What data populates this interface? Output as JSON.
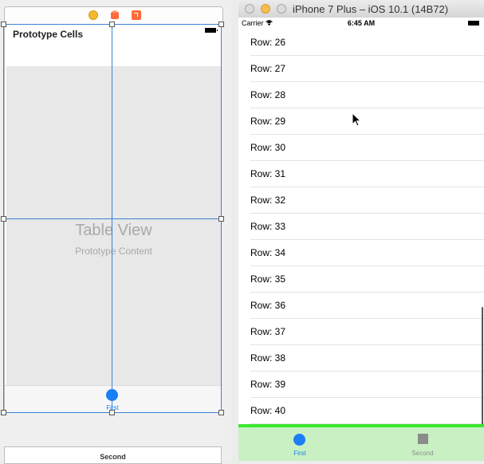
{
  "storyboard": {
    "scene_title": "Prototype Cells",
    "table_view_label": "Table View",
    "table_view_sublabel": "Prototype Content",
    "tab_label": "First",
    "second_scene_label": "Second"
  },
  "simulator": {
    "window_title": "iPhone 7 Plus – iOS 10.1 (14B72)",
    "status_bar": {
      "carrier": "Carrier",
      "time": "6:45 AM"
    },
    "rows": [
      "Row: 26",
      "Row: 27",
      "Row: 28",
      "Row: 29",
      "Row: 30",
      "Row: 31",
      "Row: 32",
      "Row: 33",
      "Row: 34",
      "Row: 35",
      "Row: 36",
      "Row: 37",
      "Row: 38",
      "Row: 39",
      "Row: 40"
    ],
    "tabs": [
      {
        "label": "First",
        "icon": "circle-icon",
        "selected": true
      },
      {
        "label": "Second",
        "icon": "square-icon",
        "selected": false
      }
    ],
    "tab_bar_color": "#c8f0c3",
    "accent_line_color": "#3be72f",
    "tint_color": "#1a7ff5"
  }
}
